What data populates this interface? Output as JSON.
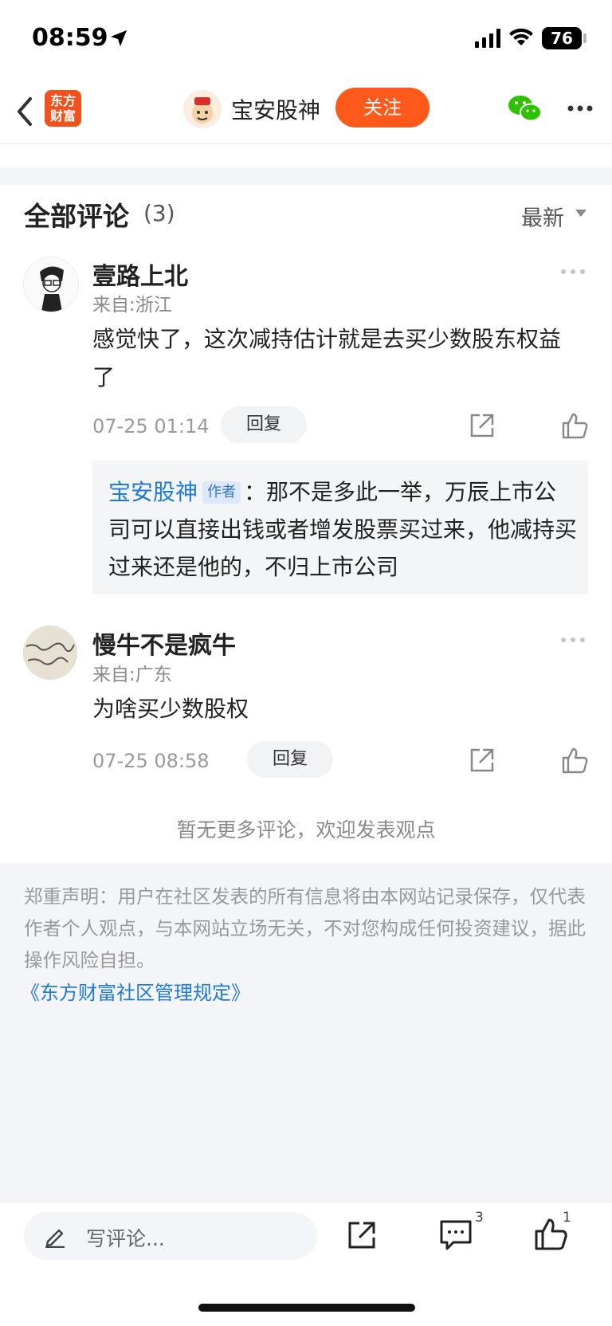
{
  "status": {
    "time": "08:59",
    "battery": "76"
  },
  "nav": {
    "back_icon": "back-icon",
    "logo_text": "东方财富",
    "name": "宝安股神",
    "follow": "关注"
  },
  "header": {
    "title": "全部评论",
    "count": "(3)",
    "sort": "最新"
  },
  "comments": [
    {
      "user": "壹路上北",
      "location": "来自:浙江",
      "text": "感觉快了，这次减持估计就是去买少数股东权益了",
      "time": "07-25 01:14",
      "reply_label": "回复",
      "reply": {
        "user": "宝安股神",
        "tag": "作者",
        "sep": "：",
        "text": "那不是多此一举，万辰上市公司可以直接出钱或者增发股票买过来，他减持买过来还是他的，不归上市公司"
      }
    },
    {
      "user": "慢牛不是疯牛",
      "location": "来自:广东",
      "text": "为啥买少数股权",
      "time": "07-25 08:58",
      "reply_label": "回复"
    }
  ],
  "no_more": "暂无更多评论，欢迎发表观点",
  "disclaimer": {
    "text": "郑重声明：用户在社区发表的所有信息将由本网站记录保存，仅代表作者个人观点，与本网站立场无关，不对您构成任何投资建议，据此操作风险自担。",
    "link": "《东方财富社区管理规定》"
  },
  "bottom": {
    "placeholder": "写评论...",
    "comment_count": "3",
    "like_count": "1"
  },
  "colors": {
    "accent": "#ff5a1b",
    "link": "#1f7adb"
  }
}
